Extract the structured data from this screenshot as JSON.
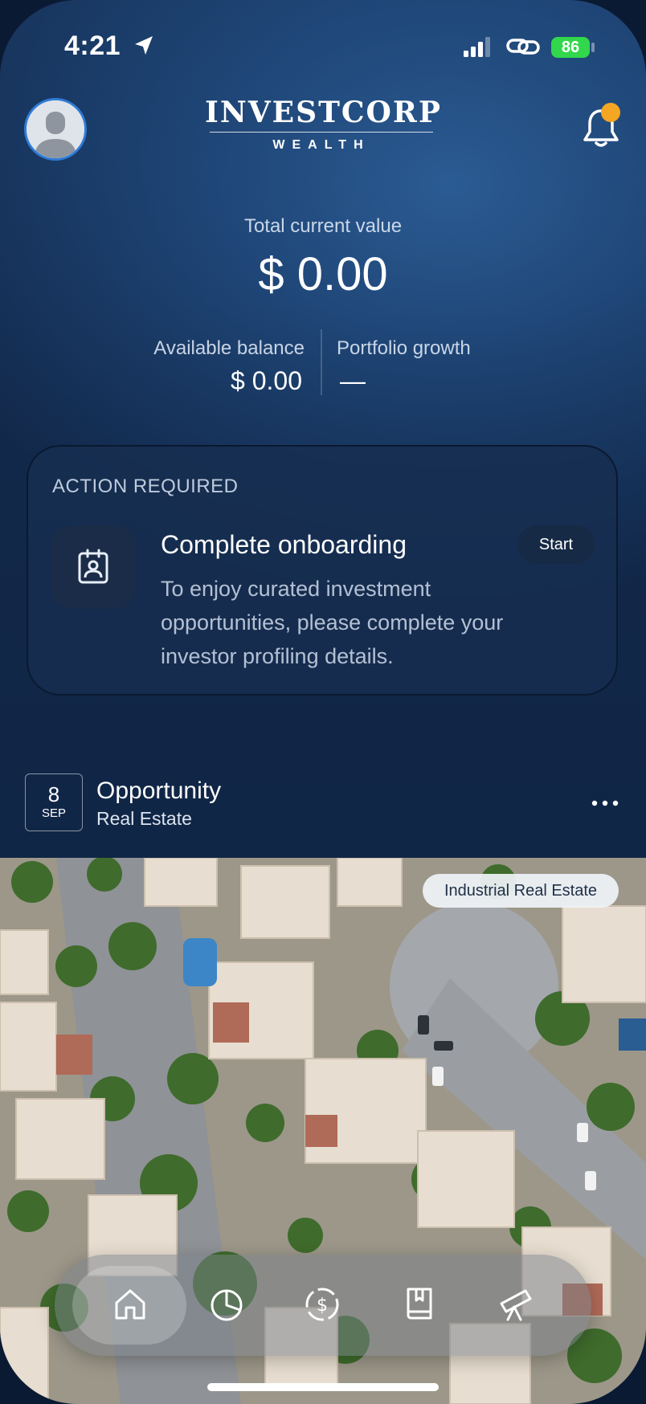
{
  "status_bar": {
    "time": "4:21",
    "battery": "86"
  },
  "header": {
    "logo_main": "INVESTCORP",
    "logo_sub": "WEALTH"
  },
  "summary": {
    "total_label": "Total current value",
    "total_value": "$ 0.00",
    "balance_label": "Available balance",
    "balance_value": "$ 0.00",
    "growth_label": "Portfolio growth",
    "growth_value": "—"
  },
  "action_card": {
    "title": "ACTION REQUIRED",
    "heading": "Complete onboarding",
    "body": "To enjoy curated investment opportunities, please complete your investor profiling details.",
    "button": "Start"
  },
  "opportunity": {
    "day": "8",
    "month": "SEP",
    "title": "Opportunity",
    "category": "Real Estate",
    "tag": "Industrial Real Estate"
  },
  "nav": {
    "items": [
      {
        "icon": "home-icon",
        "active": true
      },
      {
        "icon": "pie-chart-icon",
        "active": false
      },
      {
        "icon": "dollar-cycle-icon",
        "active": false
      },
      {
        "icon": "book-icon",
        "active": false
      },
      {
        "icon": "telescope-icon",
        "active": false
      }
    ]
  },
  "colors": {
    "brand_blue": "#1f4677",
    "accent_orange": "#f5a623",
    "battery_green": "#32d74b"
  }
}
